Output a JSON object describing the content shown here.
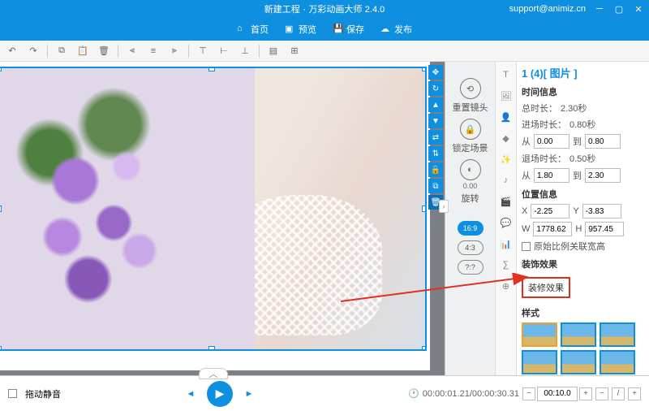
{
  "title": {
    "project": "新建工程",
    "app": "万彩动画大师",
    "version": "2.4.0",
    "support": "support@animiz.cn"
  },
  "menu": {
    "home": "首页",
    "preview": "预览",
    "save": "保存",
    "publish": "发布"
  },
  "mid": {
    "reset_camera": "重置镜头",
    "lock_scene": "锁定场景",
    "rotate": "旋转",
    "rotate_val": "0.00",
    "r1": "16:9",
    "r2": "4:3",
    "r3": "?:?"
  },
  "prop": {
    "title": "1 (4)[ 图片 ]",
    "time_section": "时间信息",
    "total_label": "总时长：",
    "total_val": "2.30秒",
    "enter_label": "进场时长：",
    "enter_val": "0.80秒",
    "from": "从",
    "to": "到",
    "enter_from": "0.00",
    "enter_to": "0.80",
    "exit_label": "退场时长：",
    "exit_val": "0.50秒",
    "exit_from": "1.80",
    "exit_to": "2.30",
    "pos_section": "位置信息",
    "x": "X",
    "y": "Y",
    "x_val": "-2.25",
    "y_val": "-3.83",
    "w": "W",
    "h": "H",
    "w_val": "1778.62",
    "h_val": "957.45",
    "aspect_label": "原始比例关联宽高",
    "decor_section": "装饰效果",
    "decor_btn": "装修效果",
    "style_section": "样式"
  },
  "bottom": {
    "drag_mute": "拖动静音",
    "clock": "00:00:01.21/00:00:30.31",
    "time_box": "00:10.0"
  }
}
